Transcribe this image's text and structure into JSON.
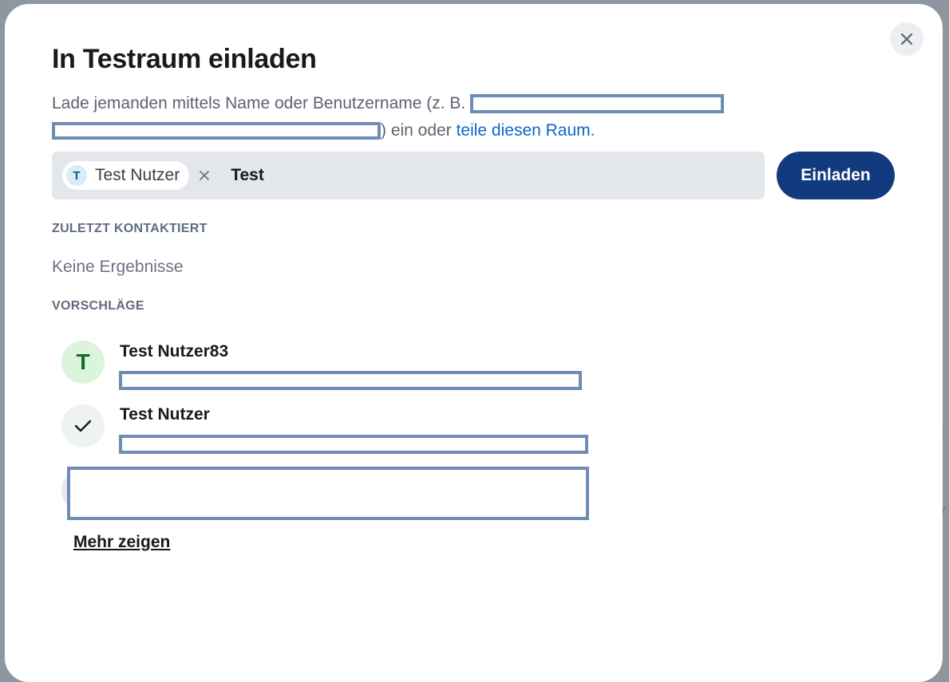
{
  "dialog": {
    "title": "In Testraum einladen",
    "close_icon": "close-icon",
    "description": {
      "text_before": "Lade jemanden mittels Name oder Benutzername (z. B.",
      "text_middle": ") ein oder",
      "link_text": "teile diesen Raum",
      "text_after": "."
    },
    "search": {
      "pill": {
        "initial": "T",
        "label": "Test Nutzer"
      },
      "value": "Test"
    },
    "invite_button": "Einladen",
    "recent_label": "ZULETZT KONTAKTIERT",
    "no_results": "Keine Ergebnisse",
    "suggestions_label": "VORSCHLÄGE",
    "suggestions": [
      {
        "initial": "T",
        "name": "Test Nutzer83",
        "selected": false
      },
      {
        "initial": "",
        "name": "Test Nutzer",
        "selected": true,
        "icon": "check-icon"
      }
    ],
    "more_link": "Mehr zeigen"
  },
  "colors": {
    "accent": "#123a7f",
    "link": "#0b67c9",
    "redaction_border": "#6d8db5"
  }
}
